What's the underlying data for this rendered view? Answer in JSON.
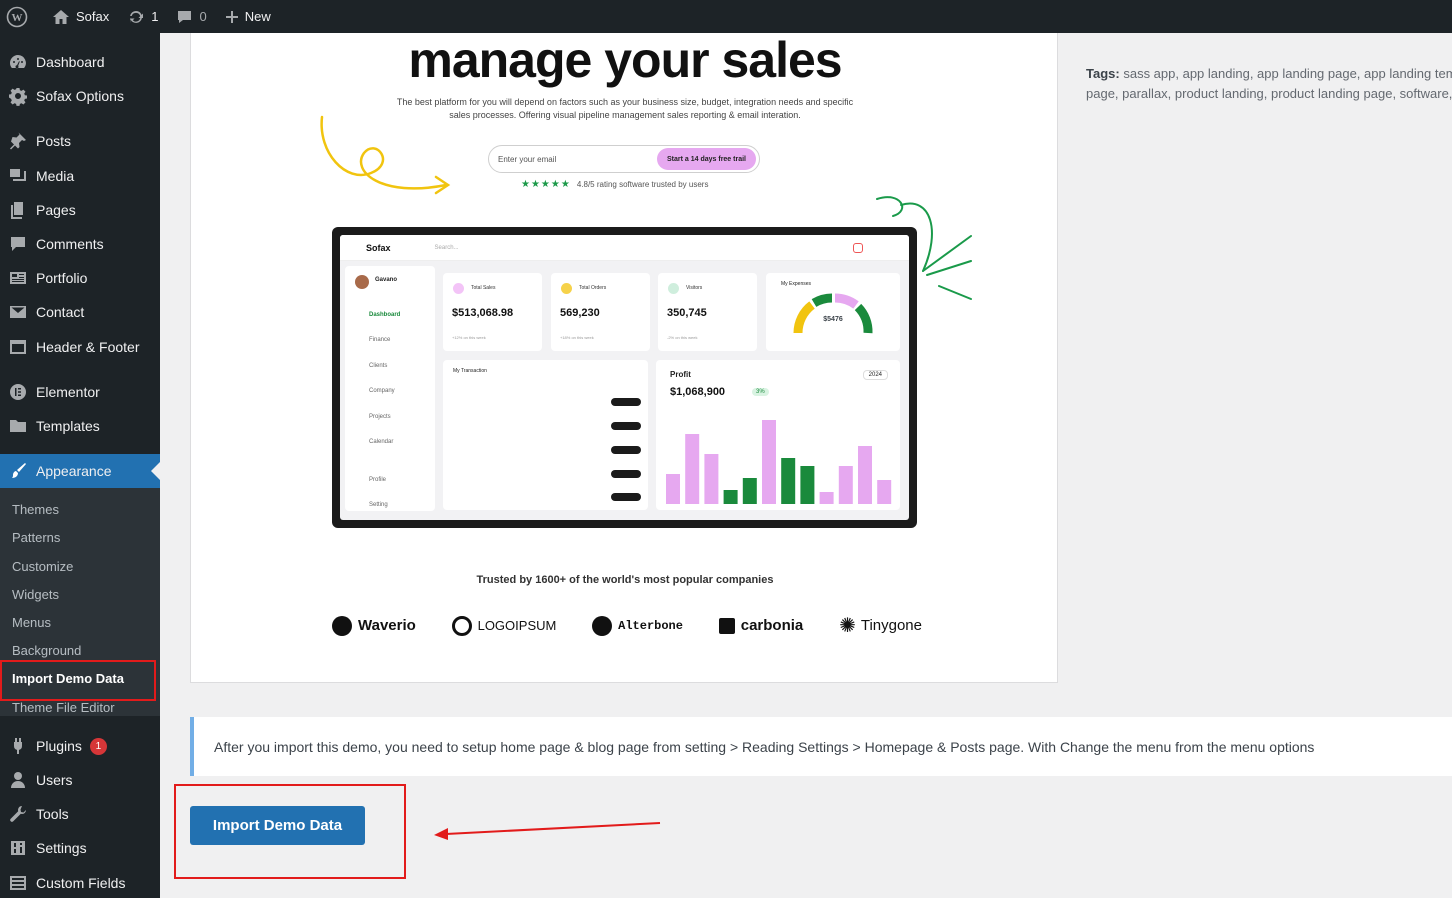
{
  "adminbar": {
    "site_name": "Sofax",
    "updates_count": "1",
    "comments_count": "0",
    "new_label": "New"
  },
  "sidebar": {
    "items": [
      {
        "label": "Dashboard",
        "icon": "dashboard-icon"
      },
      {
        "label": "Sofax Options",
        "icon": "gear-icon"
      },
      {
        "label": "Posts",
        "icon": "pin-icon"
      },
      {
        "label": "Media",
        "icon": "media-icon"
      },
      {
        "label": "Pages",
        "icon": "pages-icon"
      },
      {
        "label": "Comments",
        "icon": "comment-icon"
      },
      {
        "label": "Portfolio",
        "icon": "portfolio-icon"
      },
      {
        "label": "Contact",
        "icon": "mail-icon"
      },
      {
        "label": "Header & Footer",
        "icon": "layout-icon"
      },
      {
        "label": "Elementor",
        "icon": "elementor-icon"
      },
      {
        "label": "Templates",
        "icon": "folder-icon"
      },
      {
        "label": "Appearance",
        "icon": "brush-icon"
      },
      {
        "label": "Plugins",
        "icon": "plugin-icon",
        "badge": "1"
      },
      {
        "label": "Users",
        "icon": "user-icon"
      },
      {
        "label": "Tools",
        "icon": "wrench-icon"
      },
      {
        "label": "Settings",
        "icon": "settings-icon"
      },
      {
        "label": "Custom Fields",
        "icon": "fields-icon"
      }
    ],
    "submenu": [
      "Themes",
      "Patterns",
      "Customize",
      "Widgets",
      "Menus",
      "Background",
      "Import Demo Data",
      "Theme File Editor"
    ]
  },
  "preview": {
    "heading": "manage your sales",
    "subtext": "The best platform for you will depend on factors such as your business size, budget, integration needs and specific sales processes. Offering visual pipeline management sales reporting & email interation.",
    "email_placeholder": "Enter your email",
    "trial_button": "Start a 14 days free trail",
    "rating_text": "4.8/5 rating software trusted by users",
    "dashboard": {
      "logo": "Sofax",
      "search": "Search...",
      "user_name": "Gavano",
      "nav": [
        "Dashboard",
        "Finance",
        "Clients",
        "Company",
        "Projects",
        "Calendar",
        "Profile",
        "Setting"
      ],
      "cards": [
        {
          "label": "Total Sales",
          "value": "$513,068.98",
          "change": "+12% on this week",
          "color": "#f3c4f7"
        },
        {
          "label": "Total Orders",
          "value": "569,230",
          "change": "+18% on this week",
          "color": "#f6d24a"
        },
        {
          "label": "Visitors",
          "value": "350,745",
          "change": "-2% on this week",
          "color": "#cfeedd"
        }
      ],
      "expenses_label": "My Expenses",
      "expenses_value": "$5476",
      "transactions_label": "My Transaction",
      "profit_label": "Profit",
      "profit_value": "$1,068,900",
      "profit_change": "3%",
      "profit_year": "2024"
    },
    "trusted_text": "Trusted by 1600+ of the world's most popular companies",
    "logos": [
      "Waverio",
      "LOGOIPSUM",
      "Alterbone",
      "carbonia",
      "Tinygone"
    ]
  },
  "tags": {
    "label": "Tags:",
    "text": "sass app, app landing, app landing page, app landing template",
    "text2": "page, parallax, product landing, product landing page, software,"
  },
  "notice": {
    "text": "After you import this demo, you need to setup home page & blog page from setting > Reading Settings > Homepage & Posts page. With Change the menu from the menu options"
  },
  "import_button": "Import Demo Data",
  "colors": {
    "accent": "#2271b1",
    "sidebar_bg": "#1d2327",
    "highlight": "#e21b1b"
  }
}
